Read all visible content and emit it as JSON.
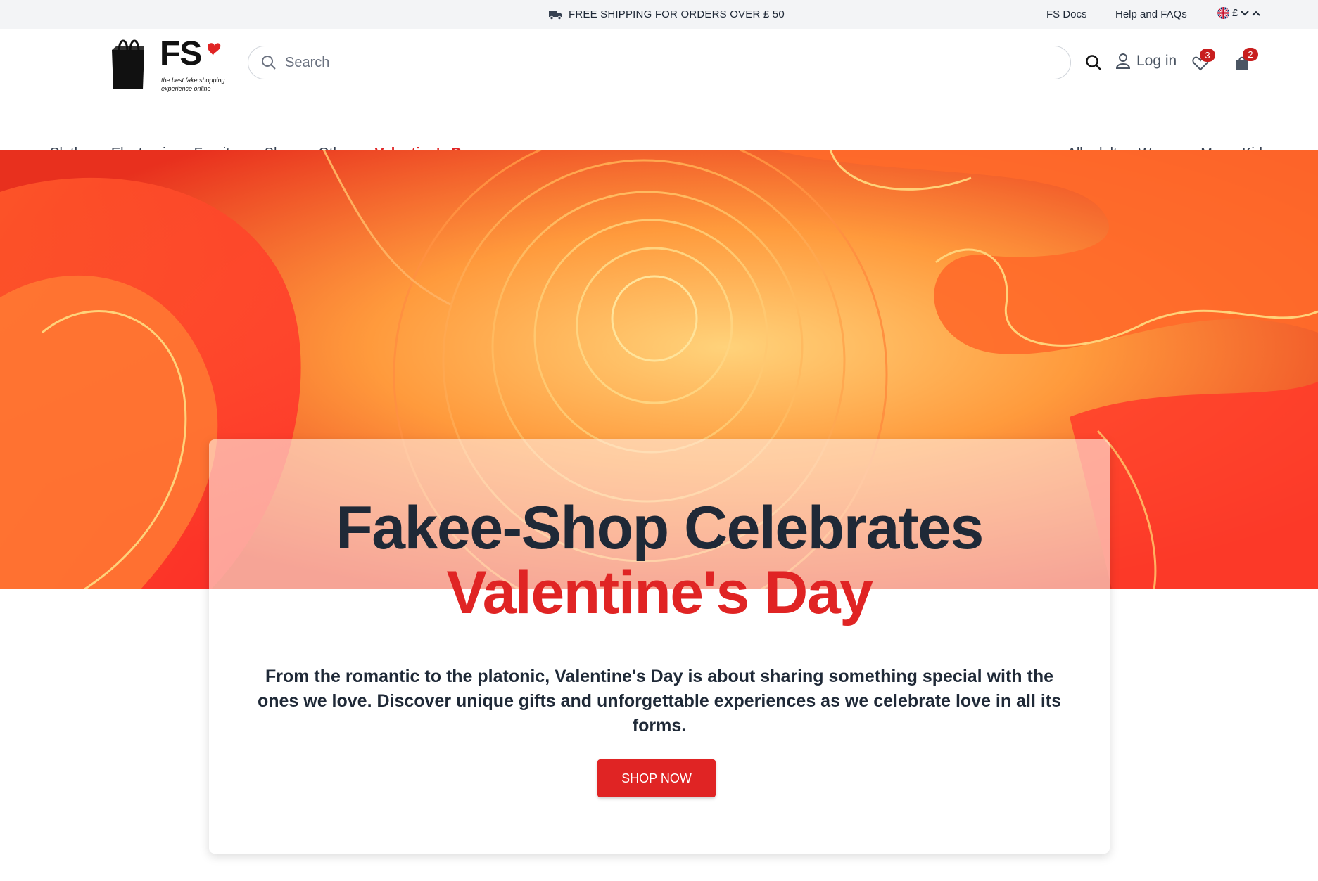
{
  "topbar": {
    "promo": "FREE SHIPPING FOR ORDERS OVER £ 50",
    "docs_link": "FS Docs",
    "help_link": "Help and FAQs",
    "currency": "£"
  },
  "header": {
    "logo_text": "FS",
    "logo_tagline": "the best fake shopping experience online",
    "search_placeholder": "Search",
    "login_label": "Log in",
    "wishlist_count": "3",
    "cart_count": "2"
  },
  "nav": {
    "categories": [
      "Clothes",
      "Electronics",
      "Furniture",
      "Shoes",
      "Others",
      "Valentine's Day"
    ],
    "audiences": [
      "All adults",
      "Women",
      "Men",
      "Kids"
    ]
  },
  "hero": {
    "title_line1": "Fakee-Shop Celebrates",
    "title_line2": "Valentine's Day",
    "description": "From the romantic to the platonic, Valentine's Day is about sharing something special with the ones we love. Discover unique gifts and unforgettable experiences as we celebrate love in all its forms.",
    "cta_label": "SHOP NOW"
  },
  "colors": {
    "accent": "#e02424",
    "text": "#1f2937",
    "topbar_bg": "#f3f4f6"
  }
}
